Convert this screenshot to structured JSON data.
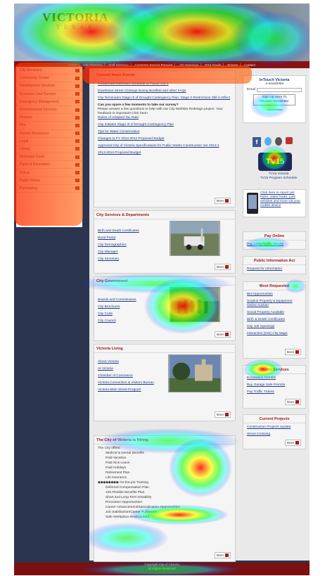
{
  "banner": {
    "logo": "VICTORIA",
    "subtitle": "TEXAS"
  },
  "topnav": [
    "Home",
    "City Directory",
    "Staff Directory",
    "Customer Service Request",
    "Job Openings",
    "RSS Feeds",
    "Browse",
    "Contact"
  ],
  "sidebar": [
    "City Secretary",
    "Community Center",
    "Development Services",
    "Economic Dev/Tourism",
    "Emergency Management",
    "Environmental Services",
    "Finance",
    "Fire",
    "Human Resources",
    "Legal",
    "Library",
    "Municipal Court",
    "Parks & Recreation",
    "Police",
    "Public Works",
    "Purchasing"
  ],
  "current_news": {
    "title": "Current News Events",
    "items": [
      "Residential Collection Schedule to Pause Oct 4",
      "Downtown Street Closings During Bootfest and other FAQs",
      "City Terminates Stage III of Drought Contingency Plan; Stage II Restrictions Still in Effect",
      "Notice of Adopted Tax Rate",
      "City Initiates Stage III of Drought Contingency Plan",
      "Tips for Water Conservation",
      "Changes to FY 2013-2014 Proposed Budget",
      "Approved City of Victoria Specifications for Public Works Construction Ver 2013.2",
      "2013-2014 Proposed Budget"
    ],
    "survey_title": "Can you spare a few moments to take our survey?",
    "survey_text": "Please answer a few questions to help with our City Website Redesign project. Your feedback is important! Click here!"
  },
  "city_services": {
    "title": "City Services & Departments",
    "items": [
      "Birth and Death Certificates",
      "Bond Portal",
      "City Demographics",
      "City Manager",
      "City Secretary"
    ]
  },
  "city_government": {
    "title": "City Government",
    "items": [
      "Boards and Commissions",
      "City Brochures",
      "City Code",
      "City Council"
    ]
  },
  "victoria_living": {
    "title": "Victoria Living",
    "items": [
      "About Victoria",
      "At Victoria",
      "Chamber of Commerce",
      "Victoria Convention & Visitors Bureau",
      "Victoria Main Street Program"
    ]
  },
  "hiring": {
    "title": "The City of Victoria is Hiring",
    "intro": "The City offers:",
    "benefits": [
      "Medical & Dental Benefits",
      "Paid Vacation",
      "Paid Sick Leave",
      "Paid Holidays",
      "Retirement Plan",
      "Life Insurance"
    ],
    "training": "◆◆◆◆◆◆◆◆ On-the-job Training",
    "more_benefits": [
      "Deferred Compensation Plan",
      "125 Flexible Benefits Plan",
      "Short and Long Term Disability",
      "Promotion Opportunities",
      "Career Advancement/Specialization Opportunities",
      "Job Satisfaction/Career Fulfillment",
      "Safe Workplace Environment"
    ]
  },
  "more_label": "More",
  "intouch": {
    "title": "InTouch Victoria",
    "subtitle": "e-newsletter",
    "email_label": "Email",
    "signup_label": "Sign Up Here To",
    "signup_label2": "Receive Newsletter",
    "provider": "GovDelivery"
  },
  "tv15": {
    "logo": "TV15",
    "caption": "TV15 Victoria",
    "caption2": "TV15 Program Schedule"
  },
  "mobile": {
    "text": "Click here to report pot holes, water leaks, junk vehicles and more via your mobile device"
  },
  "pay_online": {
    "title": "Pay Online",
    "link": "Pay Utility/Traffic Tickets"
  },
  "public_info": {
    "title": "Public Information Act",
    "link": "Request for Information"
  },
  "most_requested": {
    "title": "Most Requested",
    "items": [
      "Bid Opportunities",
      "Surplus Property & Equipment Online Auction",
      "Social Property Available",
      "Birth & Death Certificates",
      "City Job Openings",
      "Interactive (GIS) City Maps"
    ]
  },
  "online_services": {
    "title": "Online Services",
    "items": [
      "Excavation Permits",
      "Buy Garage Sale Permits",
      "Pay Traffic Tickets"
    ]
  },
  "current_projects": {
    "title": "Current Projects",
    "items": [
      "Construction Projects Update",
      "Street Crossing"
    ]
  },
  "footer": {
    "line1": "Copyright City of Victoria",
    "line2": "All Rights Reserved"
  },
  "heatmap_colors": {
    "hot": "#ff0000",
    "warm": "#ffff00",
    "mid": "#00ff00",
    "cool": "#00ffff",
    "cold": "#0000ff"
  }
}
